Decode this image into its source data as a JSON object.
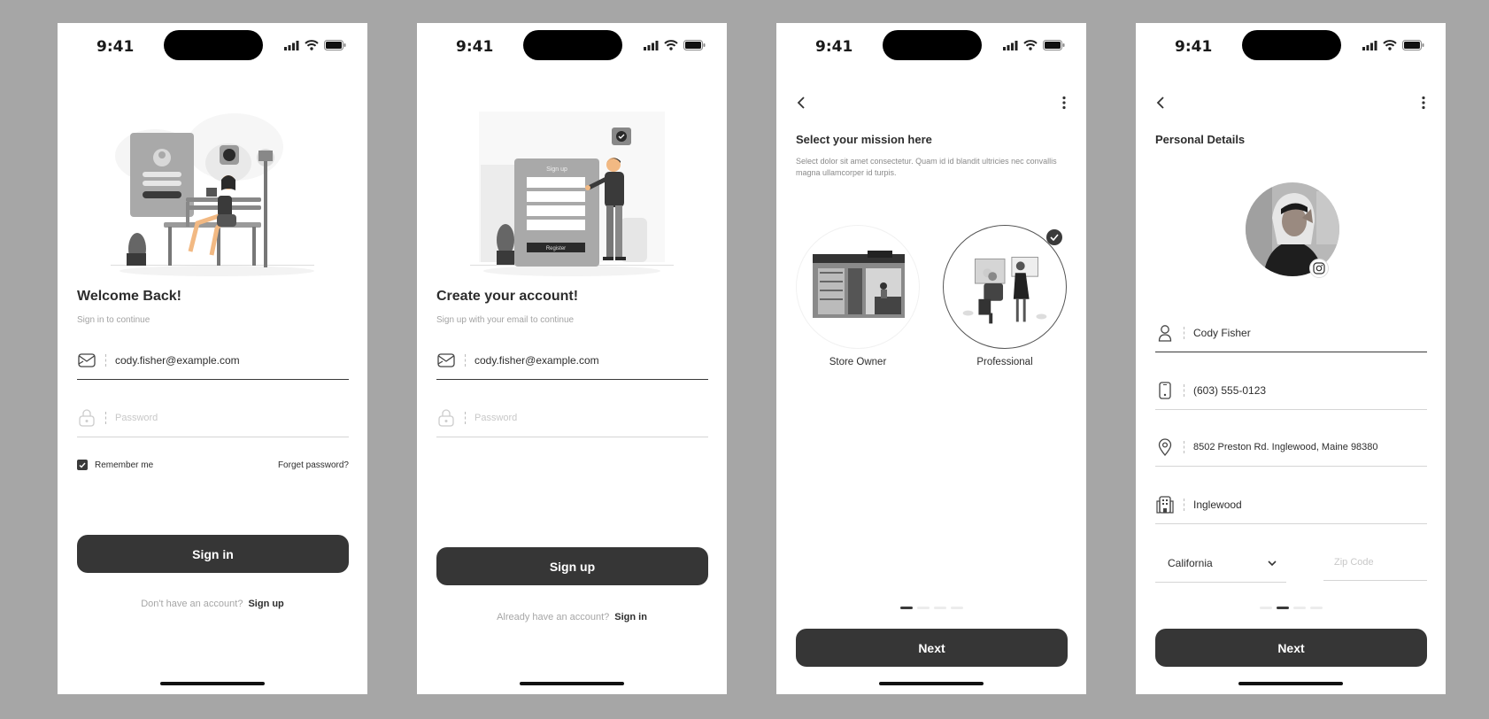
{
  "status": {
    "time": "9:41"
  },
  "signin": {
    "title": "Welcome Back!",
    "subtitle": "Sign in to continue",
    "email_value": "cody.fisher@example.com",
    "password_placeholder": "Password",
    "remember_label": "Remember me",
    "remember_checked": true,
    "forgot_label": "Forget password?",
    "button_label": "Sign in",
    "footer_text": "Don't have an account?",
    "footer_link": "Sign up"
  },
  "signup": {
    "title": "Create your account!",
    "subtitle": "Sign up with your email to continue",
    "email_value": "cody.fisher@example.com",
    "password_placeholder": "Password",
    "button_label": "Sign up",
    "footer_text": "Already have an account?",
    "footer_link": "Sign in",
    "illustration_sign_text": "Sign up",
    "illustration_register_text": "Register"
  },
  "mission": {
    "title": "Select your mission here",
    "description": "Select dolor sit amet consectetur. Quam id id blandit ultricies nec convallis magna ullamcorper id turpis.",
    "options": [
      {
        "label": "Store Owner",
        "selected": false
      },
      {
        "label": "Professional",
        "selected": true
      }
    ],
    "page_indicator": {
      "count": 4,
      "active": 0
    },
    "next_label": "Next"
  },
  "details": {
    "title": "Personal Details",
    "name": "Cody Fisher",
    "phone": "(603) 555-0123",
    "address": "8502 Preston Rd. Inglewood, Maine 98380",
    "city": "Inglewood",
    "state": "California",
    "zip_placeholder": "Zip Code",
    "page_indicator": {
      "count": 4,
      "active": 1
    },
    "next_label": "Next"
  },
  "icons": {
    "back": "chevron-left-icon",
    "more": "more-vertical-icon",
    "email": "mail-icon",
    "lock": "lock-icon",
    "user": "user-icon",
    "phone": "phone-icon",
    "location": "location-pin-icon",
    "city": "building-icon",
    "instagram": "instagram-icon"
  },
  "colors": {
    "dark": "#363636",
    "background": "#a6a6a6",
    "muted": "#a3a3a3"
  }
}
